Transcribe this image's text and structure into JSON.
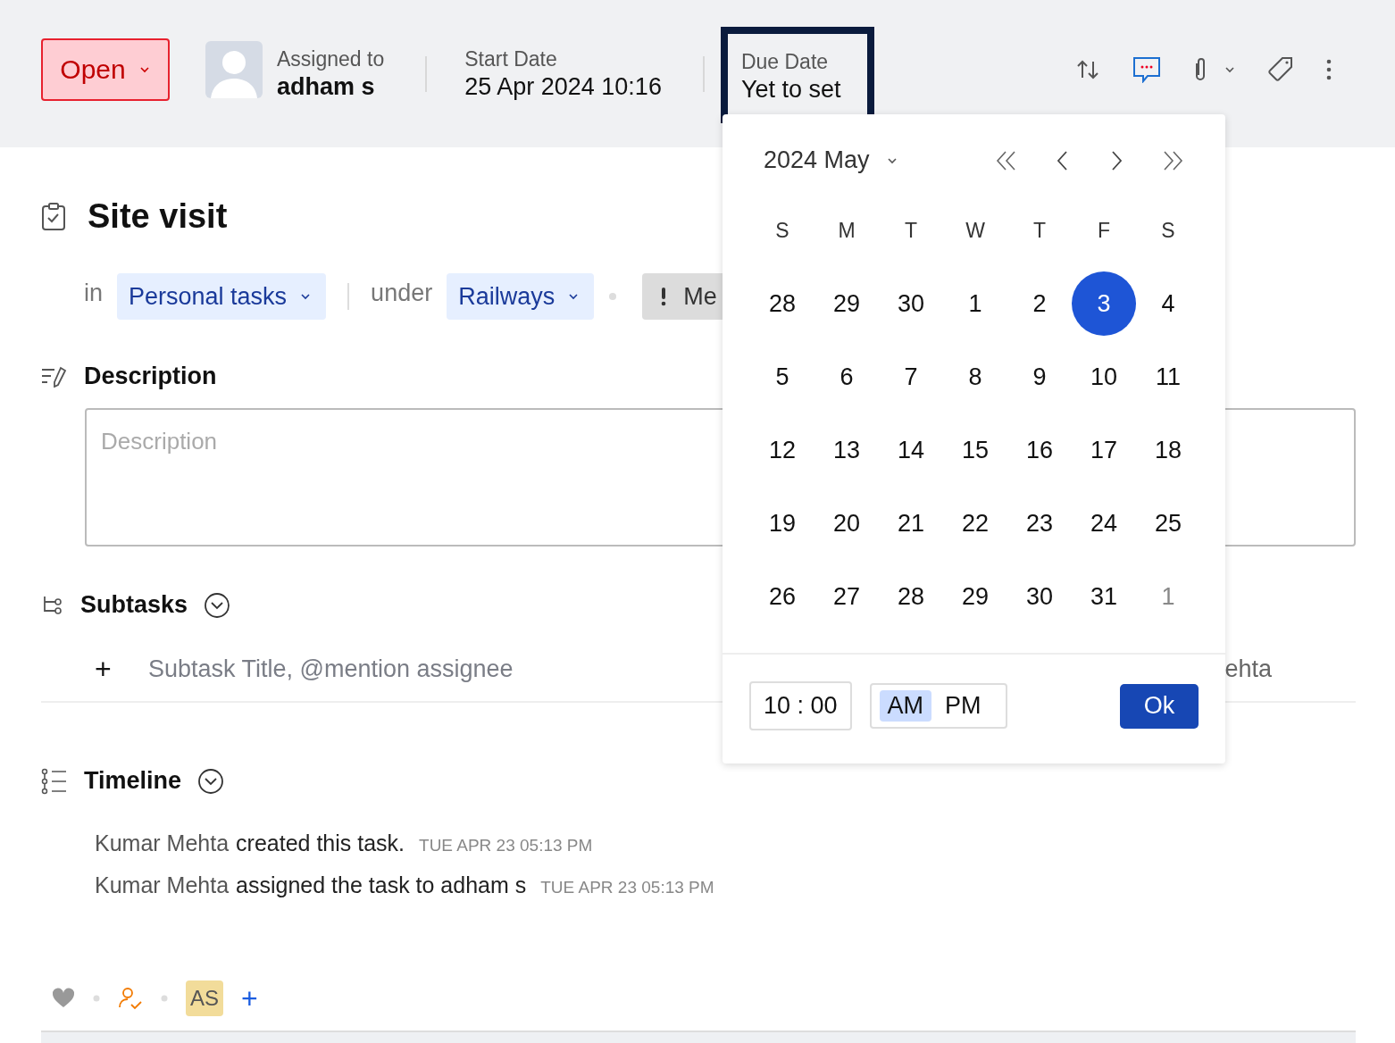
{
  "header": {
    "status": {
      "label": "Open"
    },
    "assignee": {
      "label": "Assigned to",
      "name": "adham s"
    },
    "start_date": {
      "label": "Start Date",
      "value": "25 Apr 2024 10:16"
    },
    "due_date": {
      "label": "Due Date",
      "value": "Yet to set",
      "selected": true
    }
  },
  "task": {
    "title": "Site visit",
    "in_label": "in",
    "list": "Personal tasks",
    "under_label": "under",
    "project": "Railways",
    "priority": "Me"
  },
  "description": {
    "heading": "Description",
    "placeholder": "Description"
  },
  "subtasks": {
    "heading": "Subtasks",
    "add": "+",
    "placeholder": "Subtask Title, @mention assignee",
    "column_3": "ehta"
  },
  "timeline": {
    "heading": "Timeline",
    "entries": [
      {
        "actor": "Kumar Mehta",
        "action": "created this task.",
        "time": "TUE APR 23 05:13 PM"
      },
      {
        "actor": "Kumar Mehta",
        "action": "assigned the task to adham s",
        "time": "TUE APR 23 05:13 PM"
      }
    ]
  },
  "footer": {
    "initials": "AS",
    "add": "+"
  },
  "calendar": {
    "month": "2024 May",
    "weekdays": [
      "S",
      "M",
      "T",
      "W",
      "T",
      "F",
      "S"
    ],
    "weeks": [
      [
        {
          "d": "28",
          "muted": false,
          "selected": false
        },
        {
          "d": "29",
          "muted": false,
          "selected": false
        },
        {
          "d": "30",
          "muted": false,
          "selected": false
        },
        {
          "d": "1",
          "muted": false,
          "selected": false
        },
        {
          "d": "2",
          "muted": false,
          "selected": false
        },
        {
          "d": "3",
          "muted": false,
          "selected": true
        },
        {
          "d": "4",
          "muted": false,
          "selected": false
        }
      ],
      [
        {
          "d": "5",
          "muted": false,
          "selected": false
        },
        {
          "d": "6",
          "muted": false,
          "selected": false
        },
        {
          "d": "7",
          "muted": false,
          "selected": false
        },
        {
          "d": "8",
          "muted": false,
          "selected": false
        },
        {
          "d": "9",
          "muted": false,
          "selected": false
        },
        {
          "d": "10",
          "muted": false,
          "selected": false
        },
        {
          "d": "11",
          "muted": false,
          "selected": false
        }
      ],
      [
        {
          "d": "12",
          "muted": false,
          "selected": false
        },
        {
          "d": "13",
          "muted": false,
          "selected": false
        },
        {
          "d": "14",
          "muted": false,
          "selected": false
        },
        {
          "d": "15",
          "muted": false,
          "selected": false
        },
        {
          "d": "16",
          "muted": false,
          "selected": false
        },
        {
          "d": "17",
          "muted": false,
          "selected": false
        },
        {
          "d": "18",
          "muted": false,
          "selected": false
        }
      ],
      [
        {
          "d": "19",
          "muted": false,
          "selected": false
        },
        {
          "d": "20",
          "muted": false,
          "selected": false
        },
        {
          "d": "21",
          "muted": false,
          "selected": false
        },
        {
          "d": "22",
          "muted": false,
          "selected": false
        },
        {
          "d": "23",
          "muted": false,
          "selected": false
        },
        {
          "d": "24",
          "muted": false,
          "selected": false
        },
        {
          "d": "25",
          "muted": false,
          "selected": false
        }
      ],
      [
        {
          "d": "26",
          "muted": false,
          "selected": false
        },
        {
          "d": "27",
          "muted": false,
          "selected": false
        },
        {
          "d": "28",
          "muted": false,
          "selected": false
        },
        {
          "d": "29",
          "muted": false,
          "selected": false
        },
        {
          "d": "30",
          "muted": false,
          "selected": false
        },
        {
          "d": "31",
          "muted": false,
          "selected": false
        },
        {
          "d": "1",
          "muted": true,
          "selected": false
        }
      ]
    ],
    "time": "10 : 00",
    "meridiem": [
      {
        "label": "AM",
        "selected": true
      },
      {
        "label": "PM",
        "selected": false
      }
    ],
    "ok": "Ok"
  }
}
